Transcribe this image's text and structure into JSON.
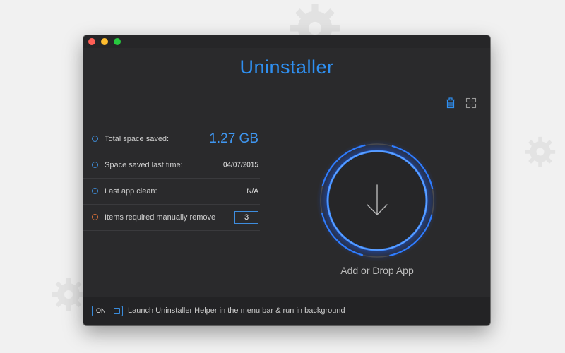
{
  "window": {
    "title": "Uninstaller"
  },
  "toolbar": {
    "trash_icon": "trash-icon",
    "grid_icon": "grid-icon"
  },
  "stats": [
    {
      "label": "Total space saved:",
      "value": "1.27 GB",
      "dot": "blue"
    },
    {
      "label": "Space saved last time:",
      "value": "04/07/2015",
      "dot": "blue"
    },
    {
      "label": "Last app clean:",
      "value": "N/A",
      "dot": "blue"
    },
    {
      "label": "Items required manually remove",
      "value": "3",
      "dot": "orange"
    }
  ],
  "drop_zone": {
    "label": "Add or Drop App",
    "icon": "arrow-down-icon"
  },
  "footer": {
    "toggle_label": "ON",
    "toggle_on": true,
    "text": "Launch Uninstaller Helper in the menu bar & run in background"
  },
  "colors": {
    "accent": "#2f8ff0",
    "glow": "#1a5cff",
    "warning_dot": "#e2733a",
    "window_bg": "#2a2a2c",
    "desktop_bg": "#f1f1f1"
  }
}
